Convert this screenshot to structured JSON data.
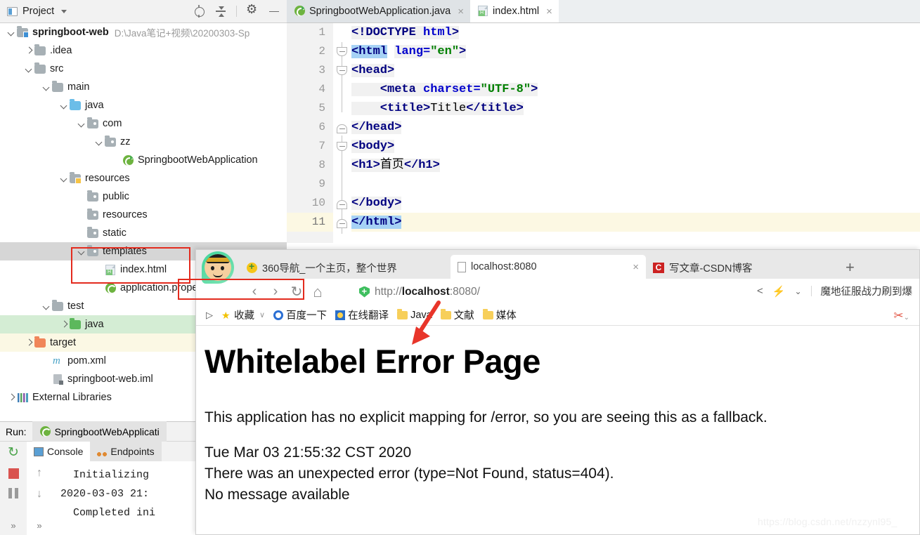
{
  "ide": {
    "project_panel": {
      "title": "Project",
      "toolbar_icons": [
        "locate-icon",
        "collapse-all-icon",
        "gear-icon",
        "minimize-icon"
      ],
      "tree": [
        {
          "label": "springboot-web",
          "path": "D:\\Java笔记+视频\\20200303-Sp",
          "indent": 0,
          "arrow": "down",
          "icon": "module-folder",
          "bold": true,
          "highlight": "none"
        },
        {
          "label": ".idea",
          "path": "",
          "indent": 1,
          "arrow": "right",
          "icon": "folder-gray",
          "bold": false,
          "highlight": "none"
        },
        {
          "label": "src",
          "path": "",
          "indent": 1,
          "arrow": "down",
          "icon": "folder-gray",
          "bold": false,
          "highlight": "none"
        },
        {
          "label": "main",
          "path": "",
          "indent": 2,
          "arrow": "down",
          "icon": "folder-gray",
          "bold": false,
          "highlight": "none"
        },
        {
          "label": "java",
          "path": "",
          "indent": 3,
          "arrow": "down",
          "icon": "folder-blue",
          "bold": false,
          "highlight": "none"
        },
        {
          "label": "com",
          "path": "",
          "indent": 4,
          "arrow": "down",
          "icon": "folder-gray-dot",
          "bold": false,
          "highlight": "none"
        },
        {
          "label": "zz",
          "path": "",
          "indent": 5,
          "arrow": "down",
          "icon": "folder-gray-dot",
          "bold": false,
          "highlight": "none"
        },
        {
          "label": "SpringbootWebApplication",
          "path": "",
          "indent": 6,
          "arrow": "none",
          "icon": "spring-run-icon",
          "bold": false,
          "highlight": "none"
        },
        {
          "label": "resources",
          "path": "",
          "indent": 3,
          "arrow": "down",
          "icon": "folder-resources",
          "bold": false,
          "highlight": "none"
        },
        {
          "label": "public",
          "path": "",
          "indent": 4,
          "arrow": "none",
          "icon": "folder-gray-dot",
          "bold": false,
          "highlight": "none"
        },
        {
          "label": "resources",
          "path": "",
          "indent": 4,
          "arrow": "none",
          "icon": "folder-gray-dot",
          "bold": false,
          "highlight": "none"
        },
        {
          "label": "static",
          "path": "",
          "indent": 4,
          "arrow": "none",
          "icon": "folder-gray-dot",
          "bold": false,
          "highlight": "none"
        },
        {
          "label": "templates",
          "path": "",
          "indent": 4,
          "arrow": "down",
          "icon": "folder-gray-dot",
          "bold": false,
          "highlight": "gray"
        },
        {
          "label": "index.html",
          "path": "",
          "indent": 5,
          "arrow": "none",
          "icon": "html-file-icon",
          "bold": false,
          "highlight": "none"
        },
        {
          "label": "application.prope",
          "path": "",
          "indent": 5,
          "arrow": "none",
          "icon": "spring-icon",
          "bold": false,
          "highlight": "none"
        },
        {
          "label": "test",
          "path": "",
          "indent": 2,
          "arrow": "down",
          "icon": "folder-gray",
          "bold": false,
          "highlight": "none"
        },
        {
          "label": "java",
          "path": "",
          "indent": 3,
          "arrow": "right",
          "icon": "folder-green",
          "bold": false,
          "highlight": "green"
        },
        {
          "label": "target",
          "path": "",
          "indent": 1,
          "arrow": "right",
          "icon": "folder-orange",
          "bold": false,
          "highlight": "yellow"
        },
        {
          "label": "pom.xml",
          "path": "",
          "indent": 2,
          "arrow": "none",
          "icon": "maven-icon",
          "bold": false,
          "highlight": "none"
        },
        {
          "label": "springboot-web.iml",
          "path": "",
          "indent": 2,
          "arrow": "none",
          "icon": "iml-file-icon",
          "bold": false,
          "highlight": "none"
        },
        {
          "label": "External Libraries",
          "path": "",
          "indent": 0,
          "arrow": "right",
          "icon": "libraries-icon",
          "bold": false,
          "highlight": "none"
        }
      ]
    },
    "editor": {
      "tabs": [
        {
          "label": "SpringbootWebApplication.java",
          "icon": "spring-run-icon",
          "active": false,
          "close": "×"
        },
        {
          "label": "index.html",
          "icon": "html-file-icon",
          "active": true,
          "close": "×"
        }
      ],
      "line_numbers": [
        "1",
        "2",
        "3",
        "4",
        "5",
        "6",
        "7",
        "8",
        "9",
        "10",
        "11"
      ],
      "current_line": 11,
      "code_lines": [
        {
          "n": 1,
          "segments": [
            {
              "t": "<!DOCTYPE ",
              "c": "tag"
            },
            {
              "t": "html",
              "c": "attr"
            },
            {
              "t": ">",
              "c": "tag"
            }
          ]
        },
        {
          "n": 2,
          "segments": [
            {
              "t": "<html",
              "c": "tag sel"
            },
            {
              "t": " ",
              "c": "plain"
            },
            {
              "t": "lang=",
              "c": "attr"
            },
            {
              "t": "\"en\"",
              "c": "val"
            },
            {
              "t": ">",
              "c": "tag"
            }
          ]
        },
        {
          "n": 3,
          "segments": [
            {
              "t": "<head>",
              "c": "tag"
            }
          ]
        },
        {
          "n": 4,
          "segments": [
            {
              "t": "    <meta ",
              "c": "tag"
            },
            {
              "t": "charset=",
              "c": "attr"
            },
            {
              "t": "\"UTF-8\"",
              "c": "val"
            },
            {
              "t": ">",
              "c": "tag"
            }
          ]
        },
        {
          "n": 5,
          "segments": [
            {
              "t": "    <title>",
              "c": "tag"
            },
            {
              "t": "Title",
              "c": "plain"
            },
            {
              "t": "</title>",
              "c": "tag"
            }
          ]
        },
        {
          "n": 6,
          "segments": [
            {
              "t": "</head>",
              "c": "tag"
            }
          ]
        },
        {
          "n": 7,
          "segments": [
            {
              "t": "<body>",
              "c": "tag"
            }
          ]
        },
        {
          "n": 8,
          "segments": [
            {
              "t": "<h1>",
              "c": "tag"
            },
            {
              "t": "首页",
              "c": "plain"
            },
            {
              "t": "</h1>",
              "c": "tag"
            }
          ]
        },
        {
          "n": 9,
          "segments": [
            {
              "t": "",
              "c": "plain"
            }
          ]
        },
        {
          "n": 10,
          "segments": [
            {
              "t": "</body>",
              "c": "tag"
            }
          ]
        },
        {
          "n": 11,
          "segments": [
            {
              "t": "</html>",
              "c": "tag selblue"
            }
          ]
        }
      ]
    },
    "run_panel": {
      "run_label": "Run:",
      "config_name": "SpringbootWebApplicati",
      "config_icon": "spring-icon",
      "tabs": [
        {
          "label": "Console",
          "icon": "console-icon",
          "active": true
        },
        {
          "label": "Endpoints",
          "icon": "endpoints-icon",
          "active": false
        }
      ],
      "side_buttons": [
        "rerun-icon",
        "stop-icon",
        "pause-icon",
        "expand-more-icon"
      ],
      "gutter_buttons": [
        "up-arrow-icon",
        "down-arrow-icon",
        "expand-more-icon"
      ],
      "console_lines": [
        "  Initializing",
        "2020-03-03 21:",
        "  Completed ini"
      ]
    }
  },
  "browser": {
    "avatar": "luffy-avatar",
    "tabs": [
      {
        "label": "360导航_一个主页，整个世界",
        "favicon": "360-icon",
        "active": false,
        "close": ""
      },
      {
        "label": "localhost:8080",
        "favicon": "page-icon",
        "active": true,
        "close": "×"
      },
      {
        "label": "写文章-CSDN博客",
        "favicon": "csdn-icon",
        "active": false,
        "close": ""
      }
    ],
    "new_tab": "+",
    "nav": {
      "back": "‹",
      "forward": "›",
      "reload": "↻",
      "home": "⌂"
    },
    "url": {
      "scheme": "http://",
      "host_bold": "localhost",
      "rest": ":8080/",
      "full": "http://localhost:8080/",
      "shield_icon": "security-shield-icon"
    },
    "toolbar_right": {
      "share_icon": "share-icon",
      "lightning_icon": "lightning-icon",
      "chevron_icon": "chevron-down-icon",
      "ad_text": "魔地征服战力刷到爆"
    },
    "bookmarks": [
      {
        "label": "收藏",
        "icon": "star-folder-icon",
        "chevron": "∨"
      },
      {
        "label": "百度一下",
        "icon": "baidu-icon",
        "chevron": ""
      },
      {
        "label": "在线翻译",
        "icon": "translate-icon",
        "chevron": ""
      },
      {
        "label": "Java",
        "icon": "folder-icon",
        "chevron": ""
      },
      {
        "label": "文献",
        "icon": "folder-icon",
        "chevron": ""
      },
      {
        "label": "媒体",
        "icon": "folder-icon",
        "chevron": ""
      }
    ],
    "bookmarks_left_icon": "expand-bookmarks-icon",
    "bookmarks_right_icon": "scissors-icon",
    "page": {
      "title": "Whitelabel Error Page",
      "description": "This application has no explicit mapping for /error, so you are seeing this as a fallback.",
      "lines": [
        "Tue Mar 03 21:55:32 CST 2020",
        "There was an unexpected error (type=Not Found, status=404).",
        "No message available"
      ]
    }
  },
  "annotations": {
    "red_box_url": "highlight-url-box",
    "red_box_tree": "highlight-templates-box",
    "red_arrow": "pointer-arrow"
  },
  "watermark": "https://blog.csdn.net/nzzynl95_",
  "colors": {
    "annotation_red": "#e32b1e",
    "selection_blue": "#a6d2f5",
    "caret_line_yellow": "#fcf8e3",
    "tree_green": "#d4edd4",
    "tree_yellow": "#fbf8e4"
  }
}
